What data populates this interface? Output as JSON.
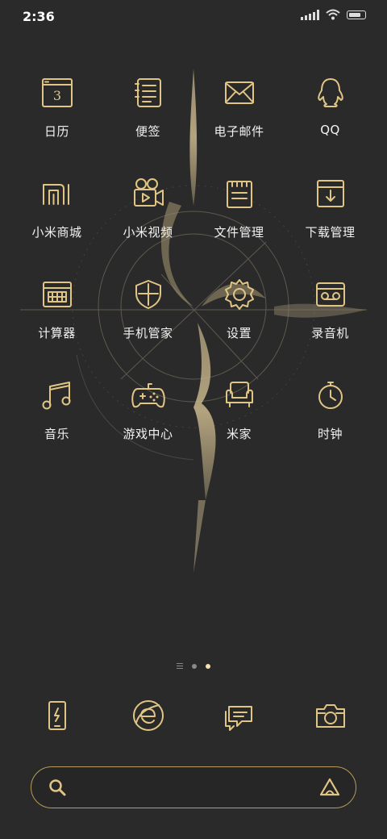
{
  "status_bar": {
    "time": "2:36"
  },
  "apps": [
    {
      "label": "日历",
      "icon": "calendar-icon",
      "day": "3"
    },
    {
      "label": "便签",
      "icon": "notes-icon"
    },
    {
      "label": "电子邮件",
      "icon": "mail-icon"
    },
    {
      "label": "QQ",
      "icon": "qq-icon"
    },
    {
      "label": "小米商城",
      "icon": "mi-store-icon"
    },
    {
      "label": "小米视频",
      "icon": "video-camera-icon"
    },
    {
      "label": "文件管理",
      "icon": "file-manager-icon"
    },
    {
      "label": "下载管理",
      "icon": "download-icon"
    },
    {
      "label": "计算器",
      "icon": "calculator-icon"
    },
    {
      "label": "手机管家",
      "icon": "shield-icon"
    },
    {
      "label": "设置",
      "icon": "gear-icon"
    },
    {
      "label": "录音机",
      "icon": "recorder-icon"
    },
    {
      "label": "音乐",
      "icon": "music-note-icon"
    },
    {
      "label": "游戏中心",
      "icon": "gamepad-icon"
    },
    {
      "label": "米家",
      "icon": "armchair-icon"
    },
    {
      "label": "时钟",
      "icon": "clock-icon"
    }
  ],
  "pager": {
    "pages": 2,
    "current": 2
  },
  "dock": [
    {
      "icon": "phone-icon"
    },
    {
      "icon": "browser-icon"
    },
    {
      "icon": "messages-icon"
    },
    {
      "icon": "camera-icon"
    }
  ],
  "search": {
    "placeholder": ""
  },
  "colors": {
    "background": "#2a2a2a",
    "gold": "#e0c585",
    "gold_dark": "#9c7f45",
    "label": "#f2f2f2"
  }
}
